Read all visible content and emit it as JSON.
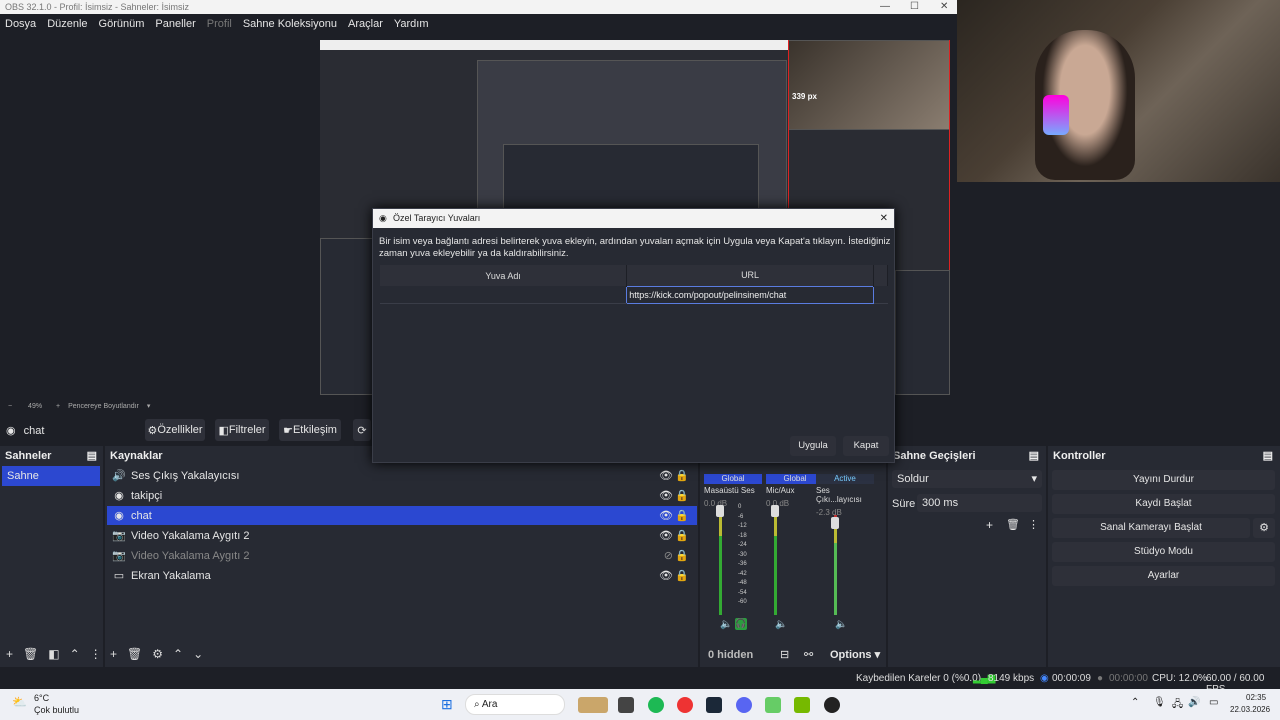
{
  "window": {
    "title": "OBS 32.1.0 - Profil: İsimsiz - Sahneler: İsimsiz"
  },
  "menu": [
    "Dosya",
    "Düzenle",
    "Görünüm",
    "Paneller",
    "Profil",
    "Sahne Koleksiyonu",
    "Araçlar",
    "Yardım"
  ],
  "preview": {
    "overlay_text": "339 px"
  },
  "zoombar": {
    "zoom": "49%",
    "label": "Pencereye Boyutlandır"
  },
  "toolbar": {
    "selected_source": "chat",
    "properties": "Özellikler",
    "filters": "Filtreler",
    "interact": "Etkileşim"
  },
  "dialog": {
    "title": "Özel Tarayıcı Yuvaları",
    "description": "Bir isim veya bağlantı adresi belirterek yuva ekleyin, ardından yuvaları açmak için Uygula veya Kapat'a tıklayın. İstediğiniz zaman yuva ekleyebilir ya da kaldırabilirsiniz.",
    "col_name": "Yuva Adı",
    "col_url": "URL",
    "row_url": "https://kick.com/popout/pelinsinem/chat",
    "apply": "Uygula",
    "close": "Kapat"
  },
  "scenes": {
    "title": "Sahneler",
    "items": [
      "Sahne"
    ]
  },
  "sources": {
    "title": "Kaynaklar",
    "items": [
      {
        "label": "Ses Çıkış Yakalayıcısı",
        "icon": "speaker-icon"
      },
      {
        "label": "takipçi",
        "icon": "globe-icon"
      },
      {
        "label": "chat",
        "icon": "globe-icon"
      },
      {
        "label": "Video Yakalama Aygıtı 2",
        "icon": "camera-icon"
      },
      {
        "label": "Video Yakalama Aygıtı 2",
        "icon": "camera-icon"
      },
      {
        "label": "Ekran Yakalama",
        "icon": "monitor-icon"
      }
    ]
  },
  "mixer": {
    "channels": [
      {
        "tag": "Global",
        "name": "Masaüstü Ses",
        "db": "0.0 dB"
      },
      {
        "tag": "Global",
        "name": "Mic/Aux",
        "db": "0.0 dB"
      },
      {
        "tag": "Active",
        "name": "Ses Çıkı...layıcısı",
        "db": "-2.3 dB"
      }
    ],
    "scale": [
      "0",
      "-6",
      "-12",
      "-18",
      "-24",
      "-30",
      "-36",
      "-42",
      "-48",
      "-54",
      "-60"
    ],
    "hidden": "0 hidden",
    "options": "Options"
  },
  "transitions": {
    "title": "Sahne Geçişleri",
    "type": "Soldur",
    "duration_label": "Süre",
    "duration": "300 ms"
  },
  "controls": {
    "title": "Kontroller",
    "buttons": [
      "Yayını Durdur",
      "Kaydı Başlat",
      "Sanal Kamerayı Başlat",
      "Stüdyo Modu",
      "Ayarlar"
    ]
  },
  "status": {
    "dropped": "Kaybedilen Kareler 0 (%0.0)",
    "bitrate": "8149 kbps",
    "stream_time": "00:00:09",
    "rec_time": "00:00:00",
    "cpu": "CPU: 12.0%",
    "fps": "60.00 / 60.00 FPS"
  },
  "taskbar": {
    "weather_temp": "6°C",
    "weather_desc": "Çok bulutlu",
    "search": "Ara",
    "time": "02:35",
    "date": "22.03.2026"
  },
  "colors": {
    "accent": "#2c48d0",
    "bg": "#1d1f26",
    "panel": "#272a33"
  }
}
